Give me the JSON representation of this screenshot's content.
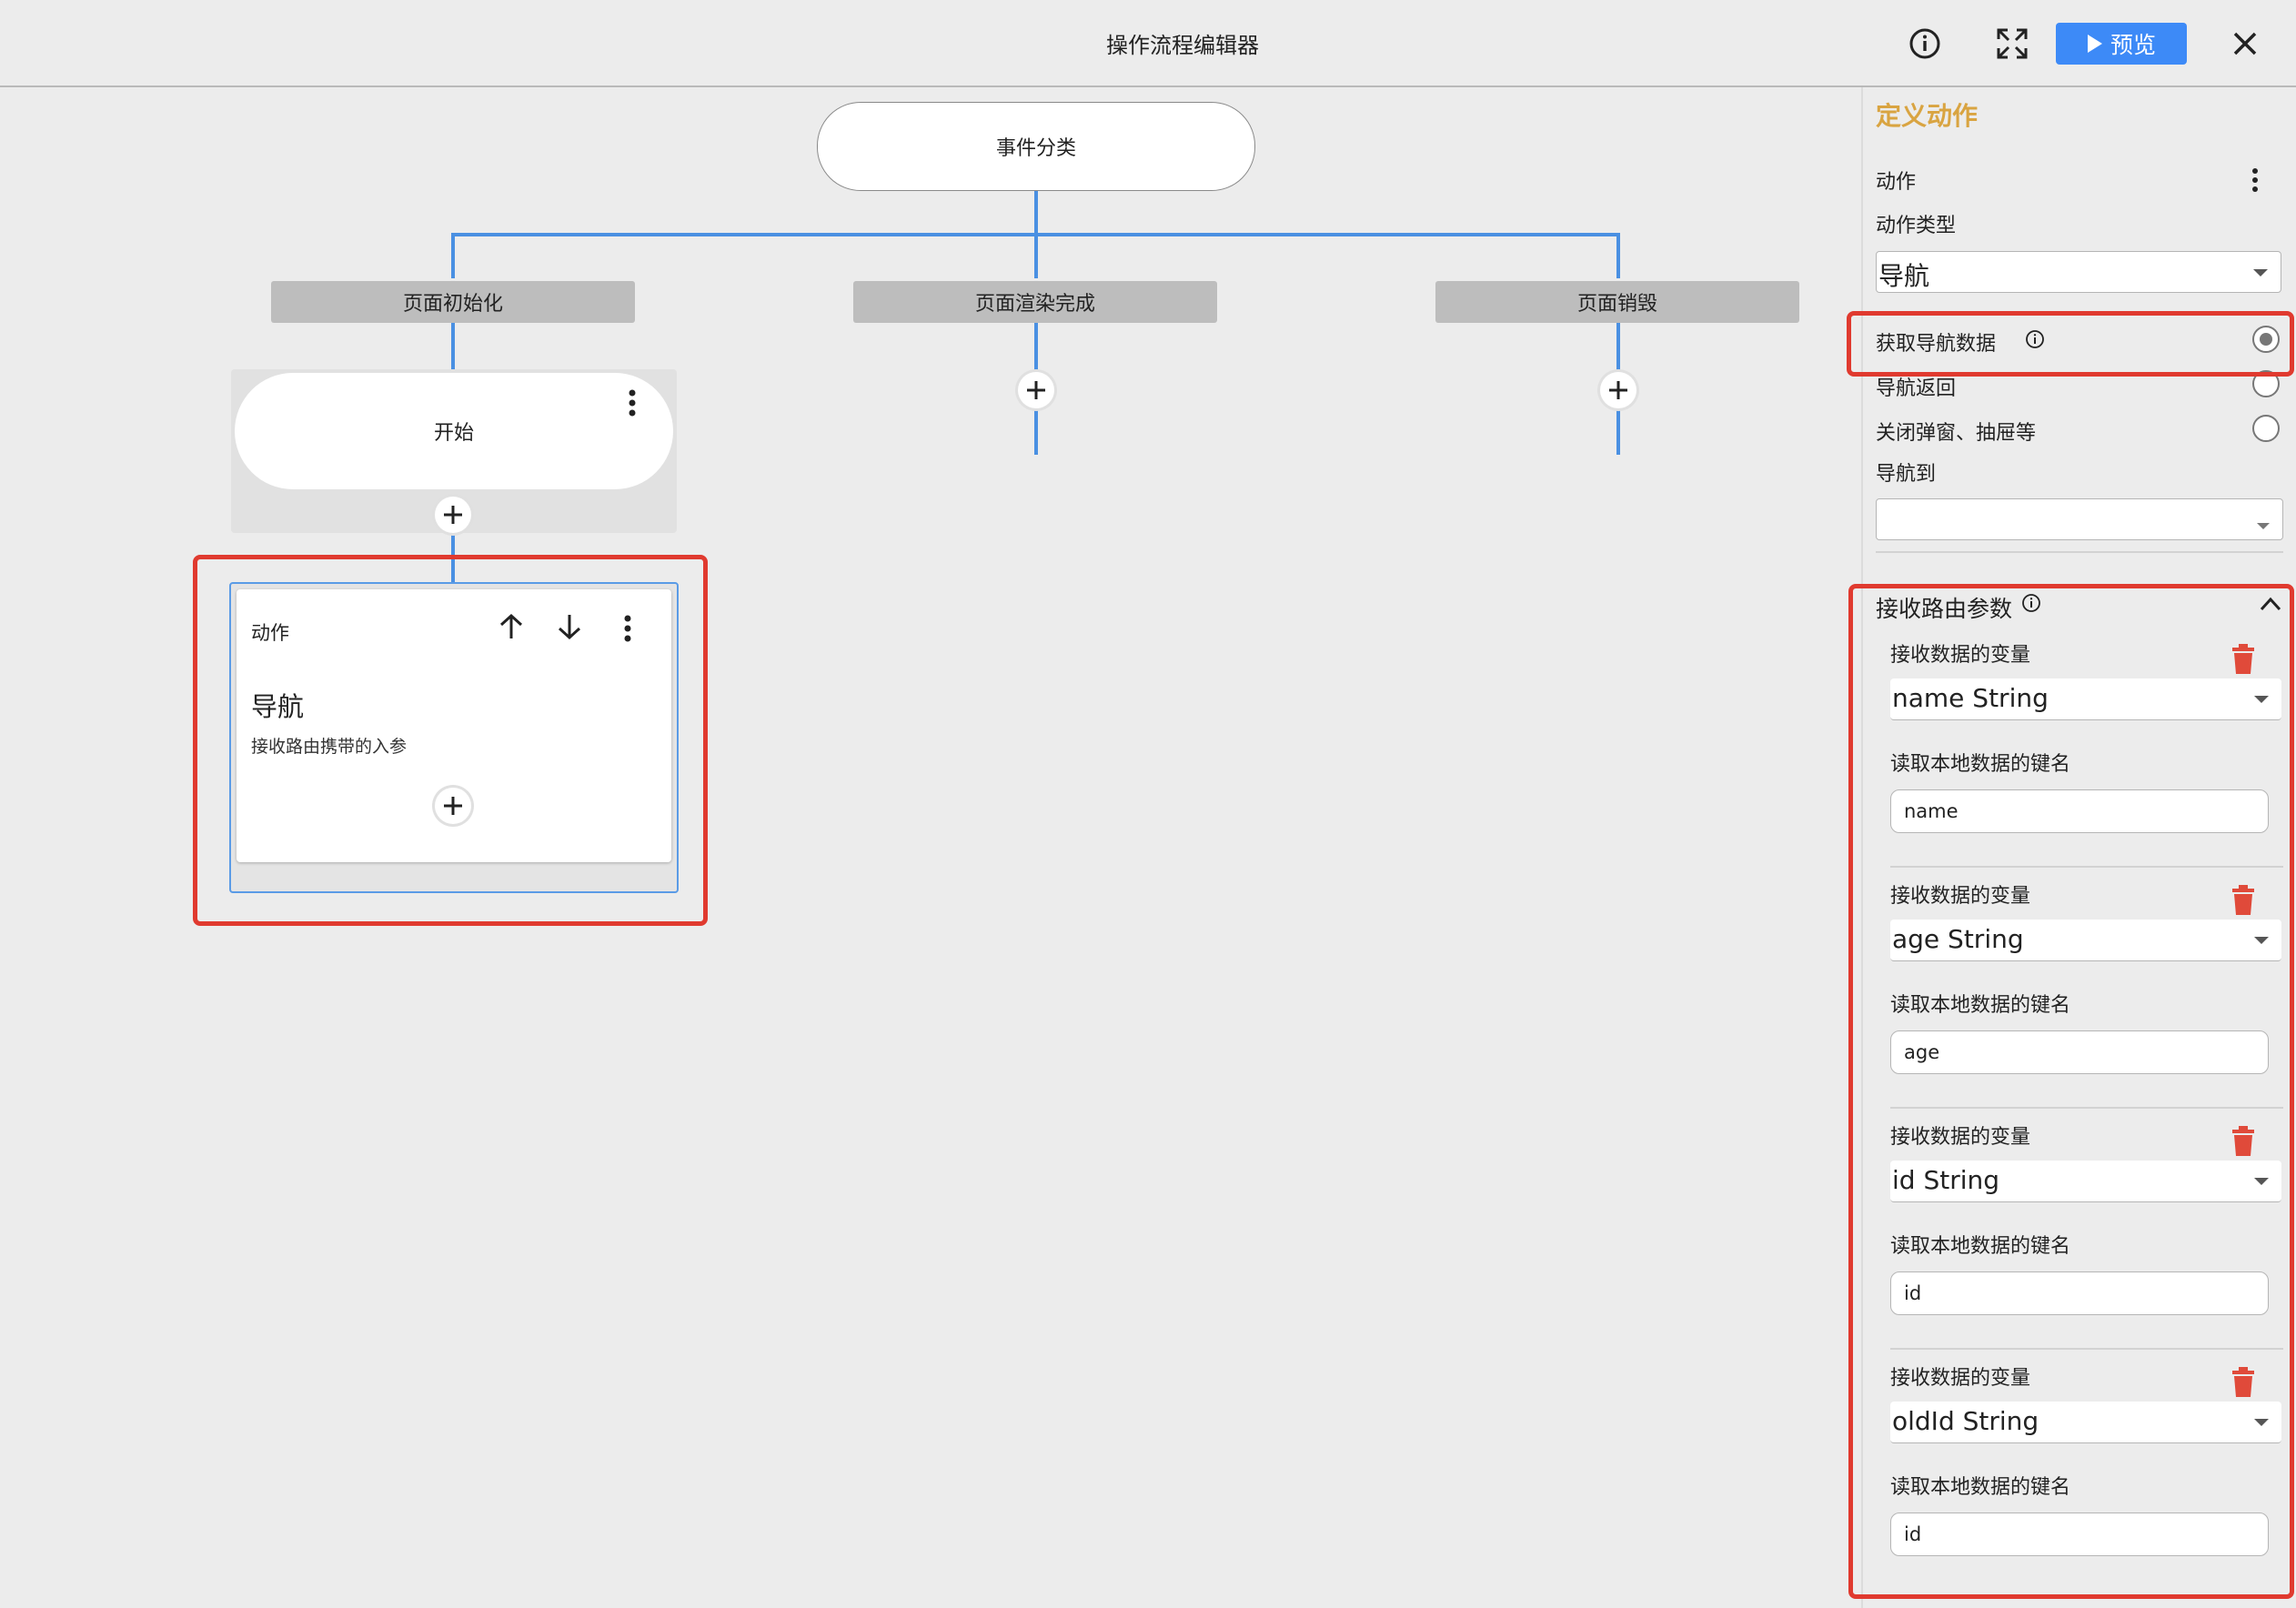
{
  "app": {
    "title": "操作流程编辑器"
  },
  "toolbar": {
    "info_icon": "info-circle-icon",
    "fullscreen_icon": "expand-arrows-icon",
    "preview_label": "预览",
    "close_icon": "close-icon"
  },
  "flow": {
    "root_label": "事件分类",
    "events": [
      {
        "label": "页面初始化"
      },
      {
        "label": "页面渲染完成"
      },
      {
        "label": "页面销毁"
      }
    ],
    "start_label": "开始",
    "action_card": {
      "type_label": "动作",
      "title": "导航",
      "description": "接收路由携带的入参"
    }
  },
  "panel": {
    "heading": "定义动作",
    "action_label": "动作",
    "action_type_label": "动作类型",
    "action_type_value": "导航",
    "radio_options": [
      {
        "label": "获取导航数据",
        "selected": true
      },
      {
        "label": "导航返回",
        "selected": false
      },
      {
        "label": "关闭弹窗、抽屉等",
        "selected": false
      }
    ],
    "navigate_to_label": "导航到",
    "navigate_to_value": "",
    "route_params": {
      "title": "接收路由参数",
      "items": [
        {
          "var_label": "接收数据的变量",
          "var_value": "name String",
          "key_label": "读取本地数据的键名",
          "key_value": "name"
        },
        {
          "var_label": "接收数据的变量",
          "var_value": "age String",
          "key_label": "读取本地数据的键名",
          "key_value": "age"
        },
        {
          "var_label": "接收数据的变量",
          "var_value": "id String",
          "key_label": "读取本地数据的键名",
          "key_value": "id"
        },
        {
          "var_label": "接收数据的变量",
          "var_value": "oldId String",
          "key_label": "读取本地数据的键名",
          "key_value": "id"
        }
      ]
    }
  },
  "colors": {
    "accent": "#3d8af7",
    "heading": "#d9a441",
    "connector": "#4a90e2",
    "annotation": "#e03a2f",
    "delete": "#e04a3a"
  }
}
